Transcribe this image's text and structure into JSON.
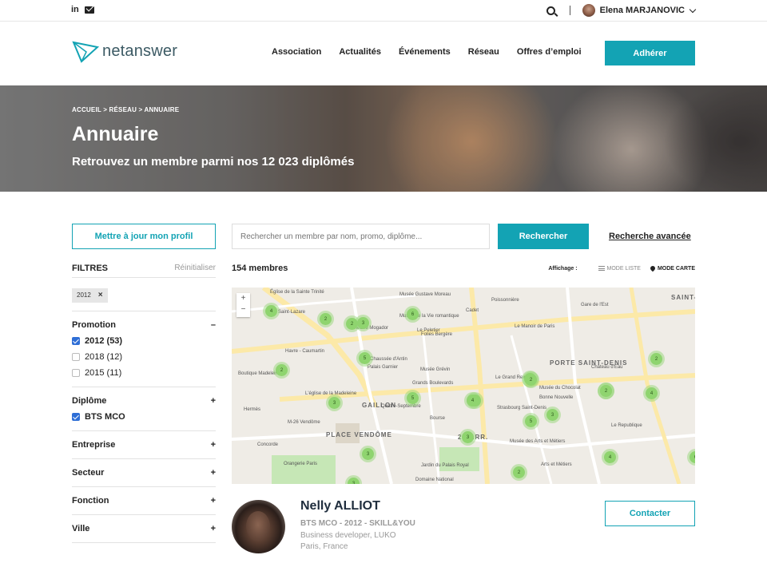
{
  "topbar": {
    "linkedin_icon": "linkedin-icon",
    "mail_icon": "mail-icon",
    "user_name": "Elena MARJANOVIC"
  },
  "header": {
    "logo_text": "netanswer",
    "nav": [
      "Association",
      "Actualités",
      "Événements",
      "Réseau",
      "Offres d’emploi"
    ],
    "cta": "Adhérer",
    "accent_color": "#13a3b4"
  },
  "hero": {
    "breadcrumb": "ACCUEIL > RÉSEAU > ANNUAIRE",
    "title": "Annuaire",
    "subtitle": "Retrouvez un membre parmi nos 12 023 diplômés"
  },
  "actions": {
    "profile_button": "Mettre à jour mon profil",
    "search_placeholder": "Rechercher un membre par nom, promo, diplôme...",
    "search_button": "Rechercher",
    "advanced_search": "Recherche avancée"
  },
  "filters": {
    "title": "FILTRES",
    "reset": "Réinitialiser",
    "active_tag": "2012",
    "tag_remove": "×",
    "sections": [
      {
        "label": "Promotion",
        "toggle": "–",
        "options": [
          {
            "label": "2012 (53)",
            "checked": true
          },
          {
            "label": "2018 (12)",
            "checked": false
          },
          {
            "label": "2015 (11)",
            "checked": false
          }
        ]
      },
      {
        "label": "Diplôme",
        "toggle": "+",
        "options": [
          {
            "label": "BTS MCO",
            "checked": true
          }
        ]
      },
      {
        "label": "Entreprise",
        "toggle": "+"
      },
      {
        "label": "Secteur",
        "toggle": "+"
      },
      {
        "label": "Fonction",
        "toggle": "+"
      },
      {
        "label": "Ville",
        "toggle": "+"
      }
    ]
  },
  "results": {
    "count": "154 membres",
    "display_label": "Affichage :",
    "mode_list": "MODE LISTE",
    "mode_map": "MODE CARTE"
  },
  "map": {
    "zoom_in": "+",
    "zoom_out": "−",
    "labels": [
      "Église de la Sainte Trinité",
      "Musée Gustave Moreau",
      "Poissonnière",
      "Cadet",
      "Gare de l'Est",
      "SAINT-DENIS",
      "Saint-Lazare",
      "Le Peletier",
      "Musée de la Vie romantique",
      "Le Manoir de Paris",
      "Théâtre Mogador",
      "Folies Bergère",
      "Havre - Caumartin",
      "Chaussée d'Antin",
      "Palais Garnier",
      "Musée Grévin",
      "Le Grand Rex",
      "Château d'Eau",
      "Boutique Madeleine",
      "L'église de la Madeleine",
      "Grands Boulevards",
      "Musée du Chocolat",
      "Bonne Nouvelle",
      "Strasbourg Saint-Denis",
      "Quatre-Septembre",
      "Bourse",
      "GAILLON",
      "PLACE VENDÔME",
      "M-26 Vendôme",
      "Le Republique",
      "Jardin du Palais Royal",
      "Musée des Arts et Métiers",
      "Arts et Métiers",
      "Domaine National",
      "Concorde",
      "Orangerie Paris",
      "2E ARR.",
      "PORTE SAINT-DENIS",
      "Hermès"
    ],
    "clusters": [
      "4",
      "2",
      "6",
      "2",
      "3",
      "5",
      "2",
      "3",
      "5",
      "4",
      "2",
      "3",
      "2",
      "4",
      "2",
      "4",
      "3",
      "3",
      "3",
      "5",
      "2",
      "6",
      "2",
      "2",
      "4"
    ]
  },
  "member": {
    "name": "Nelly ALLIOT",
    "line1": "BTS MCO - 2012 - SKILL&YOU",
    "line2": "Business developer, LUKO",
    "line3": "Paris, France",
    "contact_button": "Contacter"
  }
}
